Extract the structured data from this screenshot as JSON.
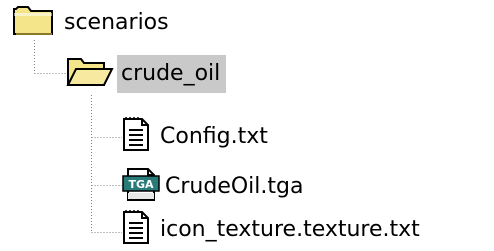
{
  "tree": {
    "root": {
      "label": "scenarios",
      "icon": "folder-closed-icon"
    },
    "folder": {
      "label": "crude_oil",
      "icon": "folder-open-icon",
      "selected": true
    },
    "files": [
      {
        "label": "Config.txt",
        "icon": "text-file-icon"
      },
      {
        "label": "CrudeOil.tga",
        "icon": "tga-file-icon",
        "badge": "TGA"
      },
      {
        "label": "icon_texture.texture.txt",
        "icon": "text-file-icon"
      }
    ]
  },
  "colors": {
    "folder_yellow": "#f4e48a",
    "folder_outline": "#000000",
    "selection_bg": "#c9c9c9",
    "tga_badge": "#2a7a7a"
  }
}
